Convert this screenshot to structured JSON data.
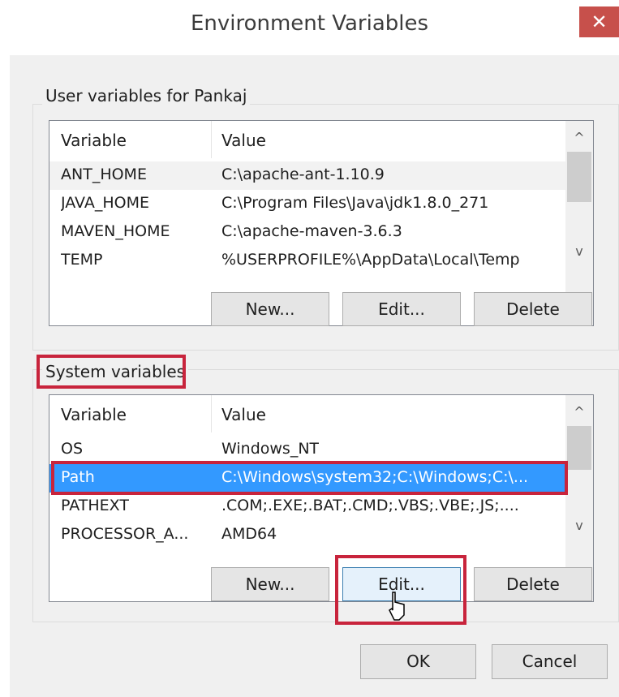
{
  "window": {
    "title": "Environment Variables",
    "close_glyph": "✕"
  },
  "user_group": {
    "label": "User variables for Pankaj",
    "columns": [
      "Variable",
      "Value"
    ],
    "rows": [
      {
        "variable": "ANT_HOME",
        "value": "C:\\apache-ant-1.10.9"
      },
      {
        "variable": "JAVA_HOME",
        "value": "C:\\Program Files\\Java\\jdk1.8.0_271"
      },
      {
        "variable": "MAVEN_HOME",
        "value": "C:\\apache-maven-3.6.3"
      },
      {
        "variable": "TEMP",
        "value": "%USERPROFILE%\\AppData\\Local\\Temp"
      }
    ],
    "buttons": {
      "new": "New...",
      "edit": "Edit...",
      "delete": "Delete"
    }
  },
  "system_group": {
    "label": "System variables",
    "columns": [
      "Variable",
      "Value"
    ],
    "rows": [
      {
        "variable": "OS",
        "value": "Windows_NT"
      },
      {
        "variable": "Path",
        "value": "C:\\Windows\\system32;C:\\Windows;C:\\..."
      },
      {
        "variable": "PATHEXT",
        "value": ".COM;.EXE;.BAT;.CMD;.VBS;.VBE;.JS;...."
      },
      {
        "variable": "PROCESSOR_A...",
        "value": "AMD64"
      }
    ],
    "buttons": {
      "new": "New...",
      "edit": "Edit...",
      "delete": "Delete"
    }
  },
  "footer": {
    "ok": "OK",
    "cancel": "Cancel"
  },
  "icons": {
    "scroll_up": "^",
    "scroll_down": "v"
  },
  "colors": {
    "close_bg": "#c7504b",
    "selection": "#3399ff",
    "highlight": "#c8243c"
  }
}
